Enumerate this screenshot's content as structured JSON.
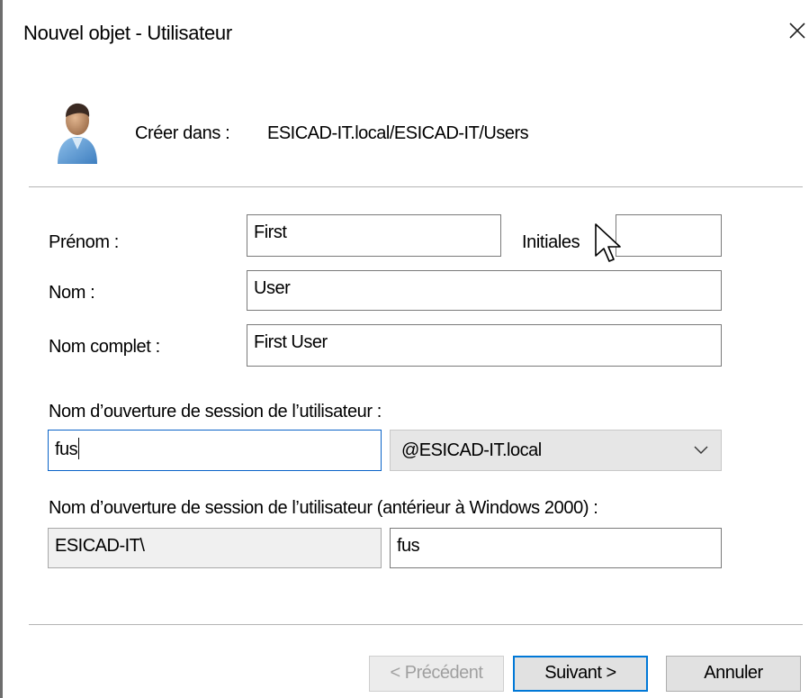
{
  "window": {
    "title": "Nouvel objet - Utilisateur",
    "close_icon": "close-icon"
  },
  "header": {
    "icon": "user-avatar-icon",
    "create_in_label": "Créer dans :",
    "create_in_path": "ESICAD-IT.local/ESICAD-IT/Users"
  },
  "form": {
    "first_name": {
      "label": "Prénom :",
      "value": "First"
    },
    "initials": {
      "label": "Initiales",
      "value": ""
    },
    "last_name": {
      "label": "Nom :",
      "value": "User"
    },
    "full_name": {
      "label": "Nom complet :",
      "value": "First User"
    },
    "logon_name": {
      "label": "Nom d’ouverture de session de l’utilisateur :",
      "value": "fus",
      "domain": "@ESICAD-IT.local"
    },
    "logon_name_pre2000": {
      "label": "Nom d’ouverture de session de l’utilisateur (antérieur à Windows 2000) :",
      "prefix": "ESICAD-IT\\",
      "value": "fus"
    }
  },
  "buttons": {
    "previous": "< Précédent",
    "next": "Suivant >",
    "cancel": "Annuler"
  },
  "colors": {
    "focus_border": "#0a63c8",
    "default_button_border": "#0078d7",
    "disabled_text": "#a0a0a0"
  }
}
